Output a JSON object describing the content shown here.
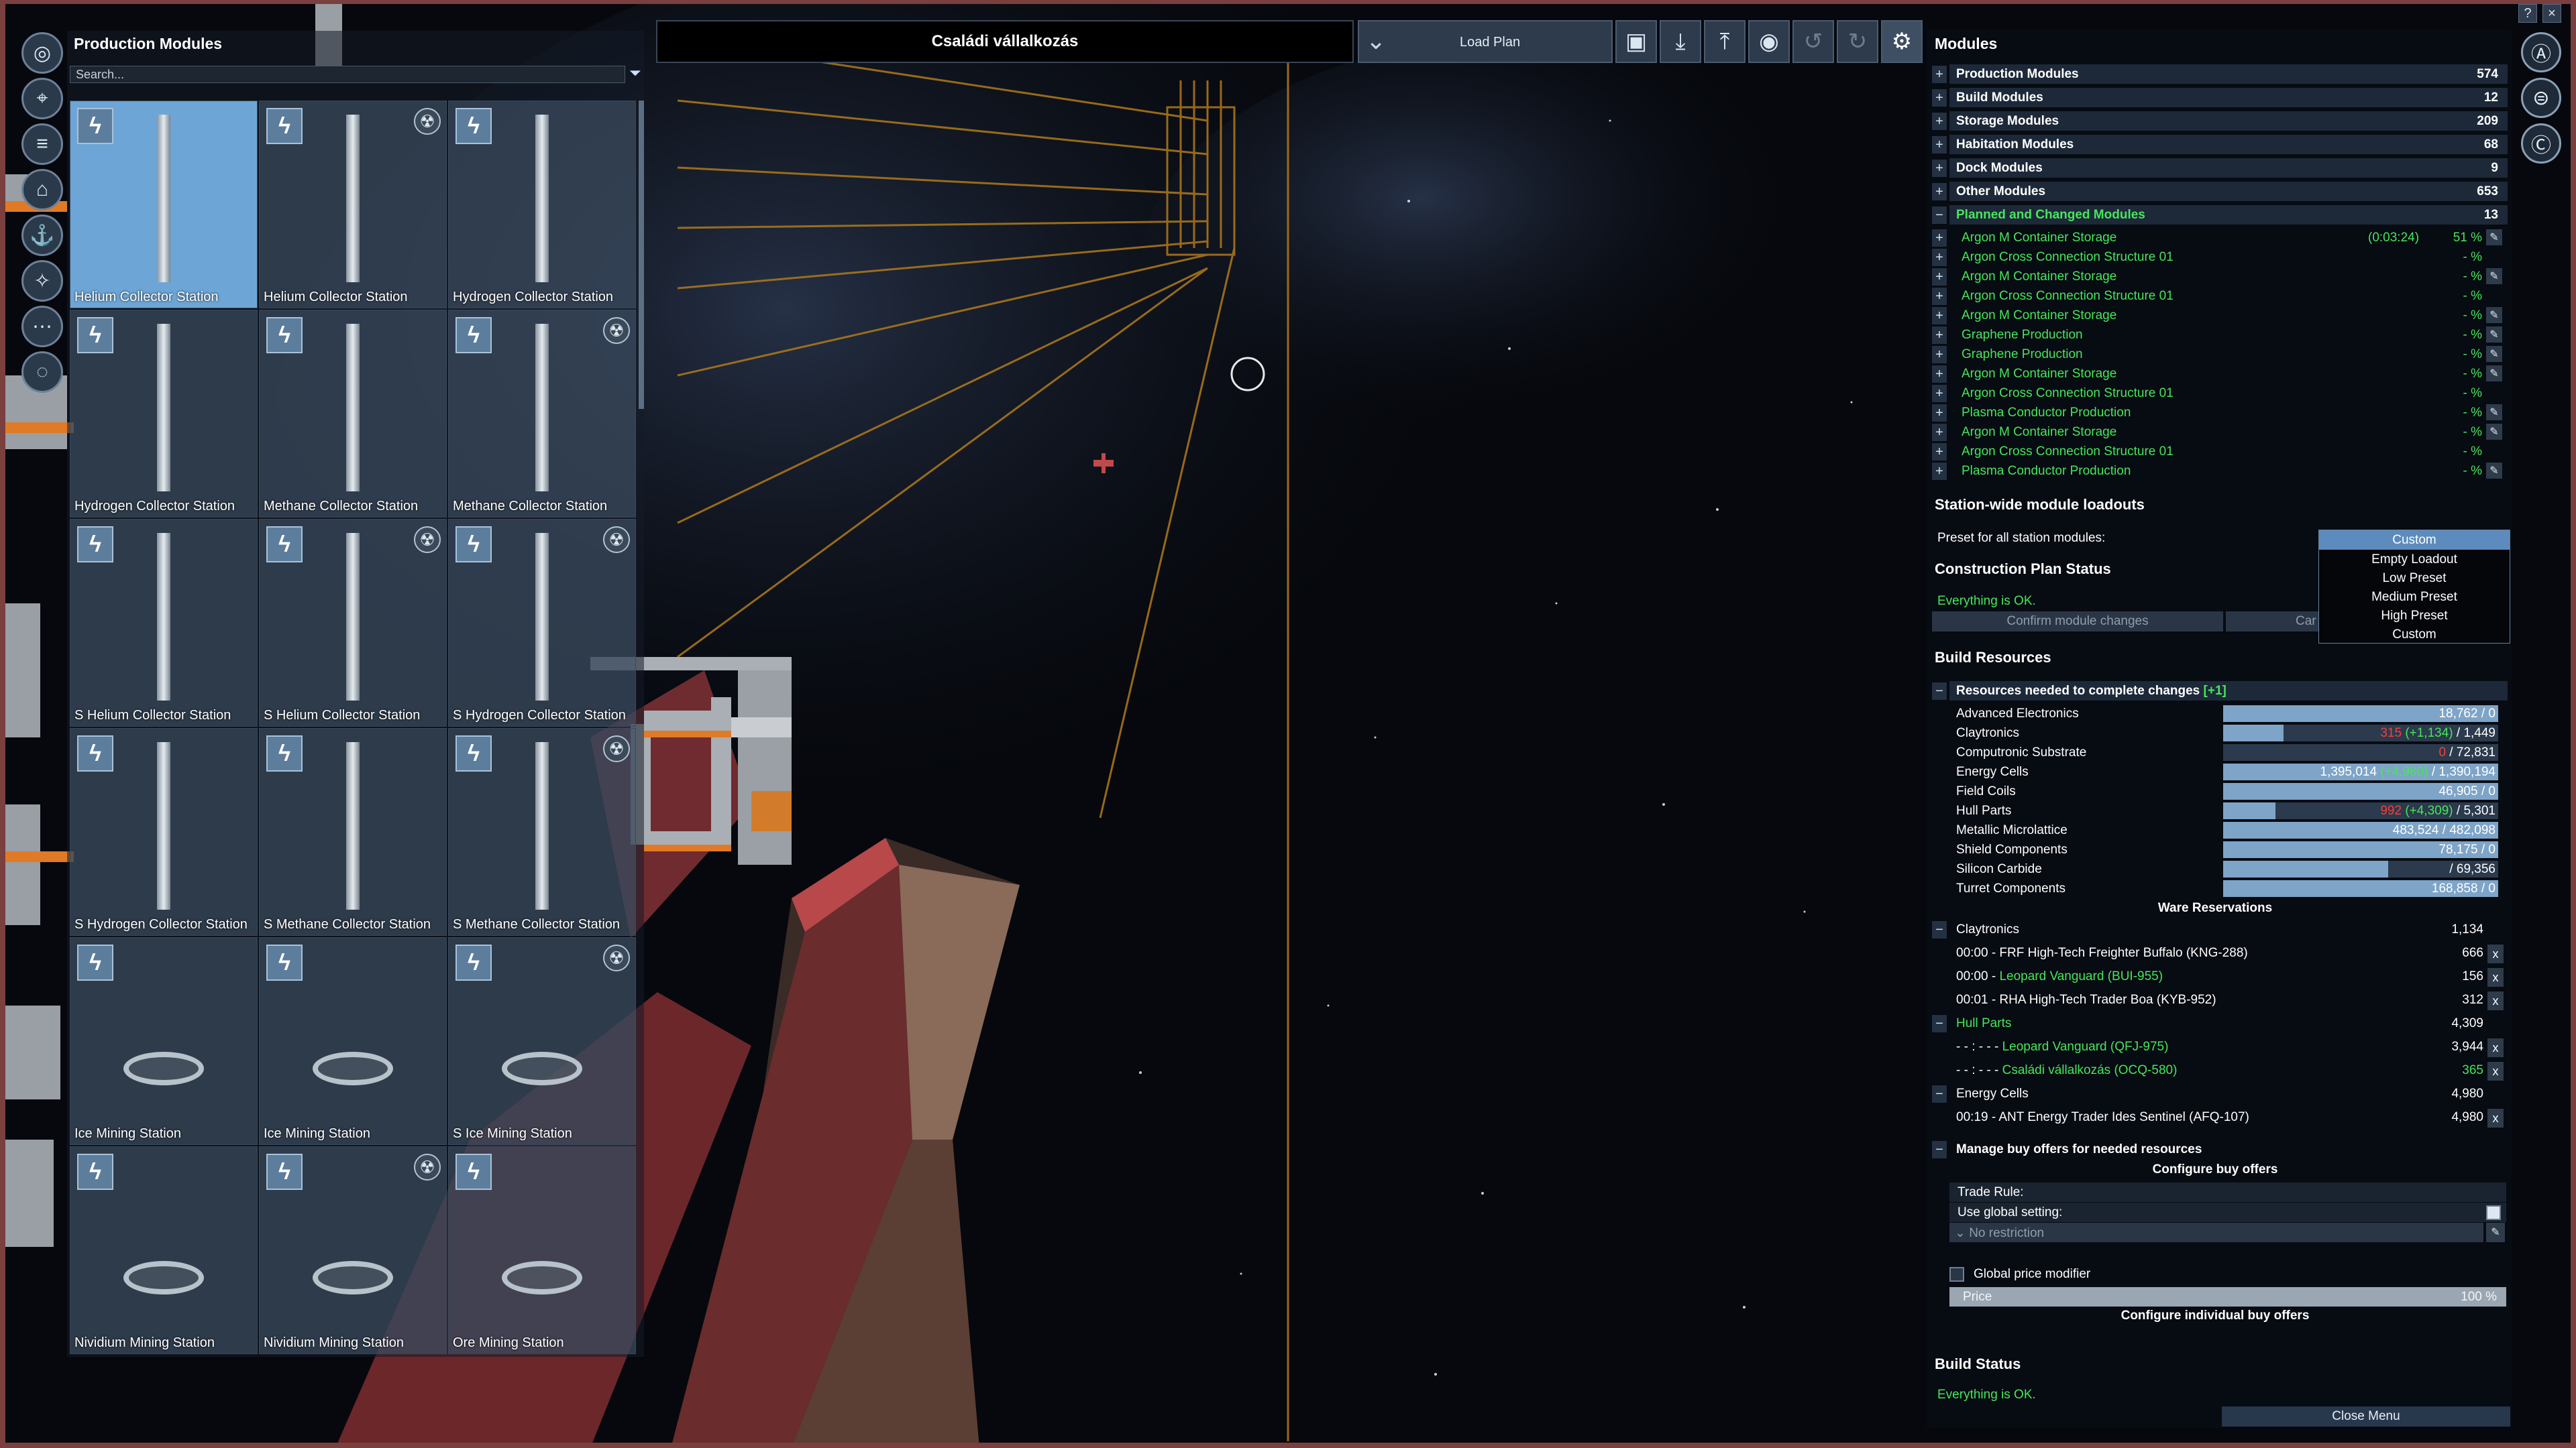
{
  "top": {
    "station_title": "Családi vállalkozás",
    "load_plan": "Load Plan"
  },
  "toolbar_icons": [
    "save-icon",
    "download-icon",
    "export-icon",
    "eye-icon",
    "undo-icon",
    "redo-icon",
    "gear-icon"
  ],
  "left_icons": [
    "station-overview-icon",
    "map-icon",
    "info-icon",
    "home-icon",
    "anchor-icon",
    "navigation-icon",
    "more-icon",
    "chat-icon"
  ],
  "production_panel": {
    "title": "Production Modules",
    "search_placeholder": "Search...",
    "tiles": [
      {
        "label": "Helium Collector Station",
        "selected": true
      },
      {
        "label": "Helium Collector Station"
      },
      {
        "label": "Hydrogen Collector Station"
      },
      {
        "label": "Hydrogen Collector Station"
      },
      {
        "label": "Methane Collector Station"
      },
      {
        "label": "Methane Collector Station"
      },
      {
        "label": "S Helium Collector Station"
      },
      {
        "label": "S Helium Collector Station"
      },
      {
        "label": "S Hydrogen Collector Station"
      },
      {
        "label": "S Hydrogen Collector Station"
      },
      {
        "label": "S Methane Collector Station"
      },
      {
        "label": "S Methane Collector Station"
      },
      {
        "label": "Ice Mining Station"
      },
      {
        "label": "Ice Mining Station"
      },
      {
        "label": "S Ice Mining Station"
      },
      {
        "label": "Nividium Mining Station"
      },
      {
        "label": "Nividium Mining Station"
      },
      {
        "label": "Ore Mining Station"
      }
    ]
  },
  "modules": {
    "title": "Modules",
    "categories": [
      {
        "name": "Production Modules",
        "count": "574"
      },
      {
        "name": "Build Modules",
        "count": "12"
      },
      {
        "name": "Storage Modules",
        "count": "209"
      },
      {
        "name": "Habitation Modules",
        "count": "68"
      },
      {
        "name": "Dock Modules",
        "count": "9"
      },
      {
        "name": "Other Modules",
        "count": "653"
      }
    ],
    "planned": {
      "name": "Planned and Changed Modules",
      "count": "13"
    },
    "planned_items": [
      {
        "name": "Argon M Container Storage",
        "time": "(0:03:24)",
        "pct": "51 %"
      },
      {
        "name": "Argon Cross Connection Structure 01",
        "pct": "- %"
      },
      {
        "name": "Argon M Container Storage",
        "pct": "- %"
      },
      {
        "name": "Argon Cross Connection Structure 01",
        "pct": "- %"
      },
      {
        "name": "Argon M Container Storage",
        "pct": "- %"
      },
      {
        "name": "Graphene Production",
        "pct": "- %"
      },
      {
        "name": "Graphene Production",
        "pct": "- %"
      },
      {
        "name": "Argon M Container Storage",
        "pct": "- %"
      },
      {
        "name": "Argon Cross Connection Structure 01",
        "pct": "- %"
      },
      {
        "name": "Plasma Conductor Production",
        "pct": "- %"
      },
      {
        "name": "Argon M Container Storage",
        "pct": "- %"
      },
      {
        "name": "Argon Cross Connection Structure 01",
        "pct": "- %"
      },
      {
        "name": "Plasma Conductor Production",
        "pct": "- %"
      }
    ]
  },
  "loadouts": {
    "title": "Station-wide module loadouts",
    "preset_label": "Preset for all station modules:",
    "selected": "Custom",
    "options": [
      "Empty Loadout",
      "Low Preset",
      "Medium Preset",
      "High Preset",
      "Custom"
    ]
  },
  "plan_status": {
    "title": "Construction Plan Status",
    "status": "Everything is OK.",
    "confirm_btn": "Confirm module changes",
    "cancel_btn": "Car"
  },
  "build_resources": {
    "title": "Build Resources",
    "needed_label": "Resources needed to complete changes",
    "needed_suffix": "[+1]",
    "items": [
      {
        "name": "Advanced Electronics",
        "fill": 1.0,
        "have": "18,762",
        "need": "0"
      },
      {
        "name": "Claytronics",
        "fill": 0.22,
        "red": "315",
        "green": "(+1,134)",
        "need": "1,449"
      },
      {
        "name": "Computronic Substrate",
        "fill": 0.0,
        "red": "0",
        "need": "72,831"
      },
      {
        "name": "Energy Cells",
        "fill": 1.0,
        "have": "1,395,014",
        "green": "(+4,980)",
        "need": "1,390,194"
      },
      {
        "name": "Field Coils",
        "fill": 1.0,
        "have": "46,905",
        "need": "0"
      },
      {
        "name": "Hull Parts",
        "fill": 0.19,
        "red": "992",
        "green": "(+4,309)",
        "need": "5,301"
      },
      {
        "name": "Metallic Microlattice",
        "fill": 1.0,
        "have": "483,524",
        "need": "482,098"
      },
      {
        "name": "Shield Components",
        "fill": 1.0,
        "have": "78,175",
        "need": "0"
      },
      {
        "name": "Silicon Carbide",
        "fill": 0.6,
        "red": "",
        "need": "69,356"
      },
      {
        "name": "Turret Components",
        "fill": 1.0,
        "have": "168,858",
        "need": "0"
      }
    ]
  },
  "reservations": {
    "title": "Ware Reservations",
    "groups": [
      {
        "ware": "Claytronics",
        "total": "1,134",
        "green": false,
        "entries": [
          {
            "text": "00:00 - FRF High-Tech Freighter Buffalo (KNG-288)",
            "amount": "666",
            "green": false
          },
          {
            "text": "00:00 - Leopard Vanguard (BUI-955)",
            "prefix": "00:00 - ",
            "name": "Leopard Vanguard (BUI-955)",
            "amount": "156",
            "green": true
          },
          {
            "text": "00:01 - RHA High-Tech Trader Boa (KYB-952)",
            "amount": "312",
            "green": false
          }
        ]
      },
      {
        "ware": "Hull Parts",
        "total": "4,309",
        "green": true,
        "entries": [
          {
            "prefix": "- - : - - - ",
            "name": "Leopard Vanguard (QFJ-975)",
            "amount": "3,944",
            "green": true
          },
          {
            "prefix": "- - : - - - ",
            "name": "Családi vállalkozás (OCQ-580)",
            "amount": "365",
            "green": true,
            "amount_green": true
          }
        ]
      },
      {
        "ware": "Energy Cells",
        "total": "4,980",
        "green": false,
        "entries": [
          {
            "text": "00:19 - ANT Energy Trader Ides Sentinel (AFQ-107)",
            "amount": "4,980",
            "green": false
          }
        ]
      }
    ]
  },
  "buy_offers": {
    "manage_label": "Manage buy offers for needed resources",
    "configure_label": "Configure buy offers",
    "trade_rule": "Trade Rule:",
    "use_global": "Use global setting:",
    "no_restriction": "No restriction",
    "global_price": "Global price modifier",
    "price_label": "Price",
    "price_value": "100 %",
    "configure_individual": "Configure individual buy offers"
  },
  "build_status": {
    "title": "Build Status",
    "status": "Everything is OK.",
    "close_btn": "Close Menu"
  },
  "window_buttons": [
    "?",
    "×"
  ],
  "colors": {
    "accent_blue": "#6da6d6",
    "ok_green": "#46e65a",
    "warn_red": "#ff3b3b",
    "frame_red": "#7a3f3f"
  }
}
